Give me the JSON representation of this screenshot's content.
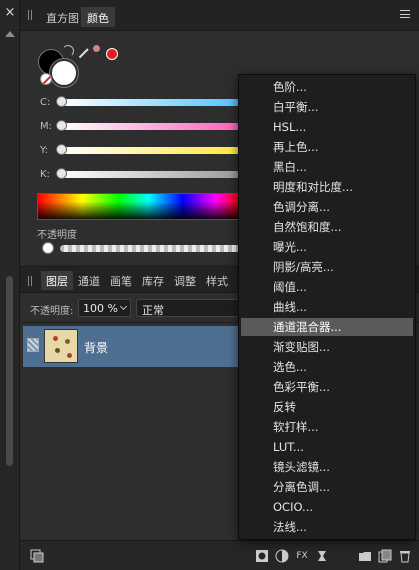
{
  "top_tabs": [
    {
      "label": "直方图",
      "active": false
    },
    {
      "label": "颜色",
      "active": true
    }
  ],
  "color_panel": {
    "sliders": [
      {
        "label": "C:",
        "value": 0,
        "color": "#4fc3ff"
      },
      {
        "label": "M:",
        "value": 0,
        "color": "#ff5fbf"
      },
      {
        "label": "Y:",
        "value": 0,
        "color": "#ffe83a"
      },
      {
        "label": "K:",
        "value": 0,
        "color": "#9a9a9a"
      }
    ],
    "opacity_label": "不透明度",
    "current_color": "#e21d1d"
  },
  "layers_panel": {
    "tabs": [
      "图层",
      "通道",
      "画笔",
      "库存",
      "调整",
      "样式"
    ],
    "active_tab": "图层",
    "opacity_label": "不透明度:",
    "opacity_value": "100 %",
    "blend_mode": "正常",
    "layers": [
      {
        "name": "背景",
        "selected": true
      }
    ]
  },
  "context_menu": {
    "items": [
      "色阶...",
      "白平衡...",
      "HSL...",
      "再上色...",
      "黑白...",
      "明度和对比度...",
      "色调分离...",
      "自然饱和度...",
      "曝光...",
      "阴影/高亮...",
      "阈值...",
      "曲线...",
      "通道混合器...",
      "渐变贴图...",
      "选色...",
      "色彩平衡...",
      "反转",
      "软打样...",
      "LUT...",
      "镜头滤镜...",
      "分离色调...",
      "OCIO...",
      "法线..."
    ],
    "highlighted_index": 12
  },
  "icons": {
    "close": "×",
    "fx": "FX"
  },
  "colors": {
    "accent_selection": "#4f6f92",
    "menu_highlight": "#5a5a5a"
  }
}
